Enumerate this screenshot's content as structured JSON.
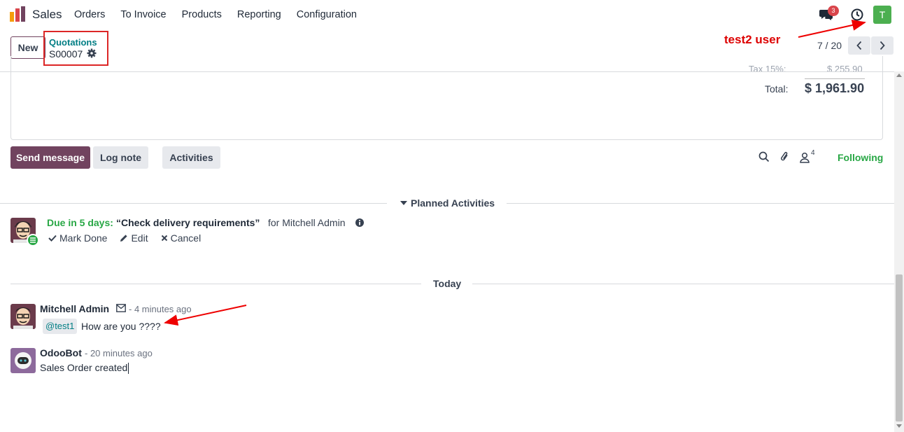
{
  "navbar": {
    "app_name": "Sales",
    "menu": [
      "Orders",
      "To Invoice",
      "Products",
      "Reporting",
      "Configuration"
    ],
    "messages_count": "3",
    "user_initial": "T"
  },
  "control_panel": {
    "new_label": "New",
    "breadcrumb_parent": "Quotations",
    "breadcrumb_current": "S00007",
    "pager": "7 / 20"
  },
  "annotation": {
    "label": "test2 user"
  },
  "totals": {
    "tax_label": "Tax 15%:",
    "tax_value": "$ 255.90",
    "total_label": "Total:",
    "total_value": "$ 1,961.90"
  },
  "chatter": {
    "send_message": "Send message",
    "log_note": "Log note",
    "activities": "Activities",
    "followers_count": "4",
    "following": "Following"
  },
  "planned_activities": {
    "title": "Planned Activities",
    "due": "Due in 5 days:",
    "summary": "“Check delivery requirements”",
    "for": "for Mitchell Admin",
    "mark_done": "Mark Done",
    "edit": "Edit",
    "cancel": "Cancel"
  },
  "today_label": "Today",
  "messages": [
    {
      "author": "Mitchell Admin",
      "date": "- 4 minutes ago",
      "mention": "@test1",
      "body": "How are you ????"
    },
    {
      "author": "OdooBot",
      "date": "- 20 minutes ago",
      "body": "Sales Order created"
    }
  ],
  "colors": {
    "primary": "#71435f",
    "link": "#017e84",
    "success": "#28a745",
    "annotation": "#dd0000"
  }
}
